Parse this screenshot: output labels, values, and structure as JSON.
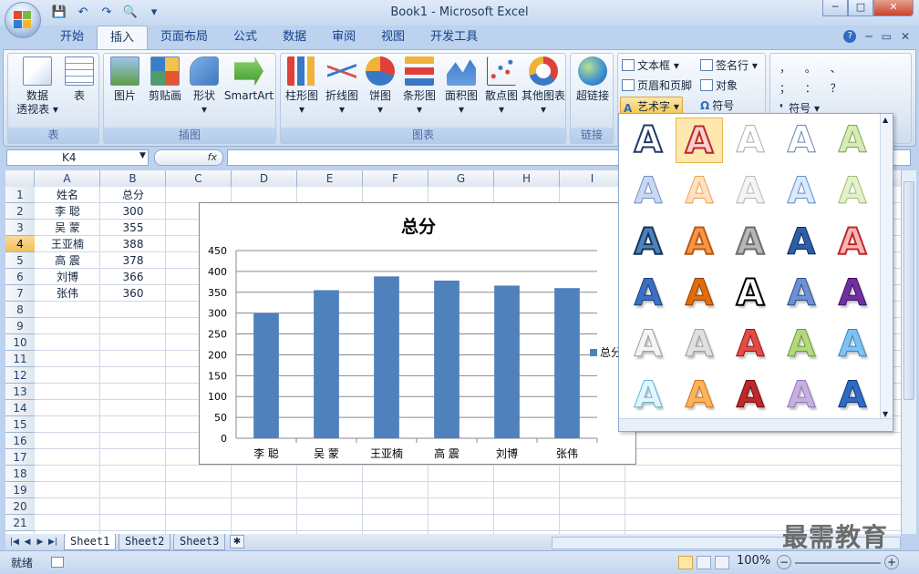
{
  "window": {
    "title": "Book1 - Microsoft Excel",
    "minimize": "─",
    "maximize": "□",
    "close": "✕"
  },
  "qat": {
    "save": "💾",
    "undo": "↶",
    "redo": "↷",
    "preview": "🔍",
    "customize": "▾"
  },
  "tabs": [
    "开始",
    "插入",
    "页面布局",
    "公式",
    "数据",
    "审阅",
    "视图",
    "开发工具"
  ],
  "active_tab": "插入",
  "help": {
    "help_icon": "?",
    "min": "─",
    "restore": "▭",
    "close": "✕"
  },
  "ribbon": {
    "group_table": {
      "label": "表",
      "pivot": "数据\n透视表 ▾",
      "table": "表"
    },
    "group_illus": {
      "label": "插图",
      "picture": "图片",
      "clipart": "剪贴画",
      "shapes": "形状\n▾",
      "smartart": "SmartArt"
    },
    "group_charts": {
      "label": "图表",
      "column": "柱形图\n▾",
      "line": "折线图\n▾",
      "pie": "饼图\n▾",
      "bar": "条形图\n▾",
      "area": "面积图\n▾",
      "scatter": "散点图\n▾",
      "other": "其他图表\n▾"
    },
    "group_links": {
      "label": "链接",
      "hyperlink": "超链接"
    },
    "group_text": {
      "textbox": "文本框 ▾",
      "header_footer": "页眉和页脚",
      "wordart": "艺术字 ▾",
      "signature": "签名行 ▾",
      "object": "对象",
      "symbol": "符号"
    },
    "group_special": {
      "r1": "，  。 、",
      "r2": "；  ：  ？",
      "symbol": "符号 ▾"
    }
  },
  "formula_bar": {
    "name_box": "K4",
    "fx": "fx",
    "formula": ""
  },
  "columns": [
    "A",
    "B",
    "C",
    "D",
    "E",
    "F",
    "G",
    "H",
    "I"
  ],
  "rows": [
    "1",
    "2",
    "3",
    "4",
    "5",
    "6",
    "7",
    "8",
    "9",
    "10",
    "11",
    "12",
    "13",
    "14",
    "15",
    "16",
    "17",
    "18",
    "19",
    "20",
    "21"
  ],
  "cells": {
    "A1": "姓名",
    "B1": "总分",
    "A2": "李  聪",
    "B2": "300",
    "A3": "吴  蒙",
    "B3": "355",
    "A4": "王亚楠",
    "B4": "388",
    "A5": "高  震",
    "B5": "378",
    "A6": "刘博",
    "B6": "366",
    "A7": "张伟",
    "B7": "360"
  },
  "selected_row": "4",
  "chart_data": {
    "type": "bar",
    "title": "总分",
    "categories": [
      "李 聪",
      "吴 蒙",
      "王亚楠",
      "高 震",
      "刘博",
      "张伟"
    ],
    "series": [
      {
        "name": "总分",
        "values": [
          300,
          355,
          388,
          378,
          366,
          360
        ]
      }
    ],
    "yticks": [
      "0",
      "50",
      "100",
      "150",
      "200",
      "250",
      "300",
      "350",
      "400",
      "450"
    ],
    "ylim": [
      0,
      450
    ],
    "grid": true,
    "legend": "right",
    "color": "#4f81bd"
  },
  "wordart_styles": [
    "A",
    "A",
    "A",
    "A",
    "A",
    "A",
    "A",
    "A",
    "A",
    "A",
    "A",
    "A",
    "A",
    "A",
    "A",
    "A",
    "A",
    "A",
    "A",
    "A",
    "A",
    "A",
    "A",
    "A",
    "A",
    "A",
    "A",
    "A",
    "A",
    "A"
  ],
  "sheets": [
    "Sheet1",
    "Sheet2",
    "Sheet3"
  ],
  "status": {
    "ready": "就绪",
    "zoom": "100%"
  },
  "watermark": "最需教育"
}
